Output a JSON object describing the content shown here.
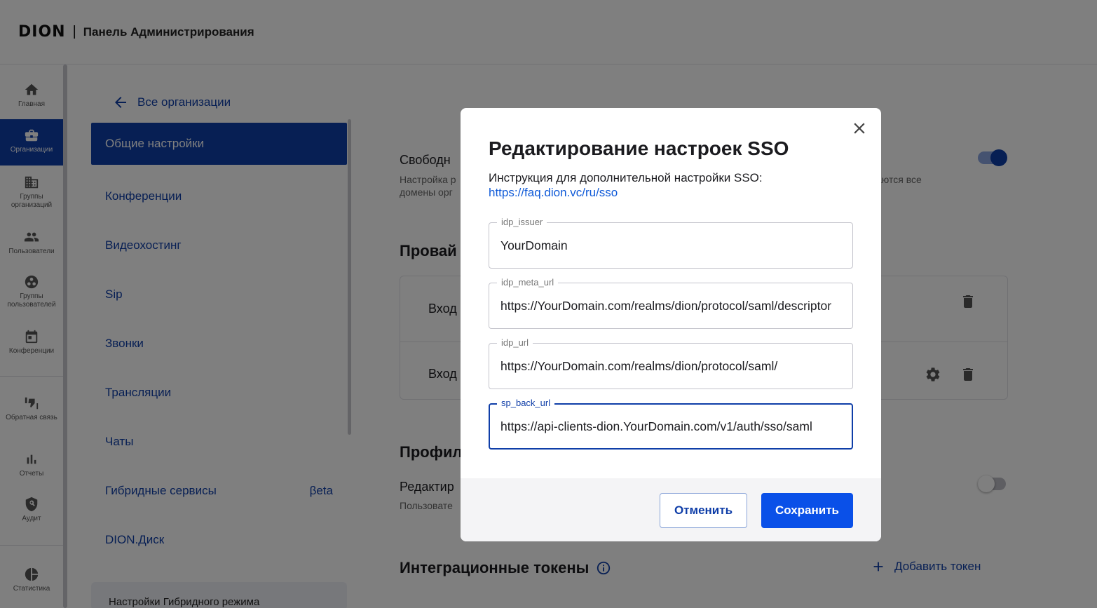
{
  "header": {
    "logo": "DION",
    "title": "Панель Администрирования"
  },
  "rail": {
    "items": [
      {
        "label": "Главная",
        "icon": "home-icon"
      },
      {
        "label": "Организации",
        "icon": "briefcase-icon"
      },
      {
        "label": "Группы организаций",
        "icon": "building-icon"
      },
      {
        "label": "Пользователи",
        "icon": "people-icon"
      },
      {
        "label": "Группы пользователей",
        "icon": "group-circle-icon"
      },
      {
        "label": "Конференции",
        "icon": "calendar-icon"
      },
      {
        "label": "Обратная связь",
        "icon": "thumbs-icon"
      },
      {
        "label": "Отчеты",
        "icon": "bar-chart-icon"
      },
      {
        "label": "Аудит",
        "icon": "shield-search-icon"
      },
      {
        "label": "Статистика",
        "icon": "pie-chart-icon"
      }
    ]
  },
  "org_nav": {
    "back_label": "Все организации",
    "items": [
      {
        "label": "Общие настройки"
      },
      {
        "label": "Конференции"
      },
      {
        "label": "Видеохостинг"
      },
      {
        "label": "Sip"
      },
      {
        "label": "Звонки"
      },
      {
        "label": "Трансляции"
      },
      {
        "label": "Чаты"
      },
      {
        "label": "Гибридные сервисы",
        "badge": "βeta"
      },
      {
        "label": "DION.Диск"
      }
    ],
    "hybrid_settings": "Настройки Гибридного режима"
  },
  "main": {
    "free_reg_title": "Свободн",
    "free_reg_desc_1": "Настройка р",
    "free_reg_desc_2": "домены орг",
    "free_reg_desc_right": "аются все",
    "providers_title": "Провай",
    "provider_row_1": "Вход",
    "provider_row_2": "Вход",
    "profile_title": "Профил",
    "profile_edit": "Редактир",
    "profile_edit_desc": "Пользовате",
    "tokens_title": "Интеграционные токены",
    "add_token": "Добавить токен"
  },
  "modal": {
    "title": "Редактирование настроек SSO",
    "instruction": "Инструкция для дополнительной настройки SSO:",
    "link": "https://faq.dion.vc/ru/sso",
    "fields": [
      {
        "label": "idp_issuer",
        "value": "YourDomain"
      },
      {
        "label": "idp_meta_url",
        "value": "https://YourDomain.com/realms/dion/protocol/saml/descriptor"
      },
      {
        "label": "idp_url",
        "value": "https://YourDomain.com/realms/dion/protocol/saml/"
      },
      {
        "label": "sp_back_url",
        "value": "https://api-clients-dion.YourDomain.com/v1/auth/sso/saml"
      }
    ],
    "cancel_label": "Отменить",
    "save_label": "Сохранить"
  },
  "colors": {
    "brand": "#0f3ea8",
    "save_button": "#0a50e8",
    "link": "#0f5ad8"
  }
}
